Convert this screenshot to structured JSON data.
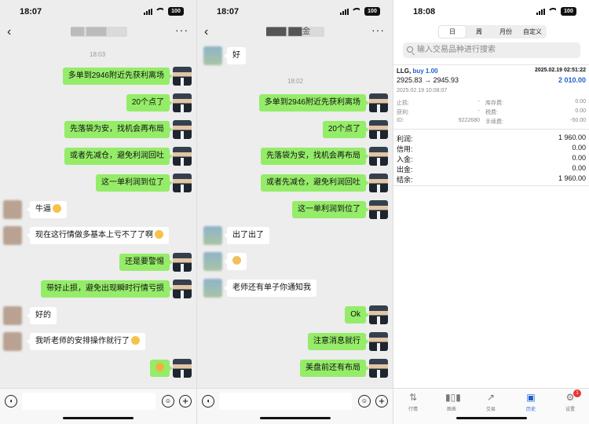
{
  "chat1": {
    "time": "18:07",
    "battery": "100",
    "title": "▇▇ ▇▇▇",
    "timestamp": "18:03",
    "messages": [
      {
        "side": "me",
        "text": "多单到2946附近先获利离场"
      },
      {
        "side": "me",
        "text": "20个点了"
      },
      {
        "side": "me",
        "text": "先落袋为安，找机会再布局"
      },
      {
        "side": "me",
        "text": "或者先减仓，避免利润回吐"
      },
      {
        "side": "me",
        "text": "这一单利润到位了"
      },
      {
        "side": "other",
        "text": "牛逼"
      },
      {
        "side": "other",
        "text": "现在这行情做多基本上亏不了了啊"
      },
      {
        "side": "me",
        "text": "还是要警惕"
      },
      {
        "side": "me",
        "text": "带好止损，避免出现瞬时行情亏损"
      },
      {
        "side": "other",
        "text": "好的"
      },
      {
        "side": "other",
        "text": "我听老师的安排操作就行了"
      },
      {
        "side": "me",
        "text": ""
      }
    ]
  },
  "chat2": {
    "time": "18:07",
    "battery": "100",
    "title": "▇▇▇ ▇▇金",
    "timestamp": "18:02",
    "messages": [
      {
        "side": "other",
        "text": "好"
      },
      {
        "side": "me",
        "text": "多单到2946附近先获利离场"
      },
      {
        "side": "me",
        "text": "20个点了"
      },
      {
        "side": "me",
        "text": "先落袋为安，找机会再布局"
      },
      {
        "side": "me",
        "text": "或者先减仓，避免利润回吐"
      },
      {
        "side": "me",
        "text": "这一单利润到位了"
      },
      {
        "side": "other",
        "text": "出了出了"
      },
      {
        "side": "other",
        "text": ""
      },
      {
        "side": "other",
        "text": "老师还有单子你通知我"
      },
      {
        "side": "me",
        "text": "Ok"
      },
      {
        "side": "me",
        "text": "注意消息就行"
      },
      {
        "side": "me",
        "text": "美盘前还有布局"
      }
    ]
  },
  "trade": {
    "time": "18:08",
    "battery": "100",
    "tabs": [
      "日",
      "周",
      "月份",
      "自定义"
    ],
    "search_placeholder": "输入交易品种进行搜索",
    "order": {
      "symbol": "LLG,",
      "side": "buy 1.00",
      "date": "2025.02.19 02:51:22",
      "prices": "2925.83 → 2945.93",
      "profit": "2 010.00",
      "close_time": "2025.02.19 10:08:07",
      "sl_label": "止损:",
      "sl_val": "-",
      "tp_label": "获利:",
      "tp_val": "-",
      "id_label": "ID:",
      "id_val": "9222680",
      "swap_label": "库存费:",
      "swap_val": "0.00",
      "tax_label": "税费:",
      "tax_val": "0.00",
      "fee_label": "手续费:",
      "fee_val": "-50.00"
    },
    "summary": [
      {
        "label": "利润:",
        "value": "1 960.00"
      },
      {
        "label": "信用:",
        "value": "0.00"
      },
      {
        "label": "入金:",
        "value": "0.00"
      },
      {
        "label": "出金:",
        "value": "0.00"
      },
      {
        "label": "结余:",
        "value": "1 960.00"
      }
    ],
    "bottom_tabs": [
      {
        "label": "行情",
        "icon": "quotes-icon"
      },
      {
        "label": "图表",
        "icon": "chart-icon"
      },
      {
        "label": "交易",
        "icon": "trade-icon"
      },
      {
        "label": "历史",
        "icon": "history-icon"
      },
      {
        "label": "设置",
        "icon": "settings-icon",
        "badge": "1"
      }
    ],
    "colors": {
      "accent": "#1f5fd1",
      "bubble": "#95ec69"
    }
  }
}
